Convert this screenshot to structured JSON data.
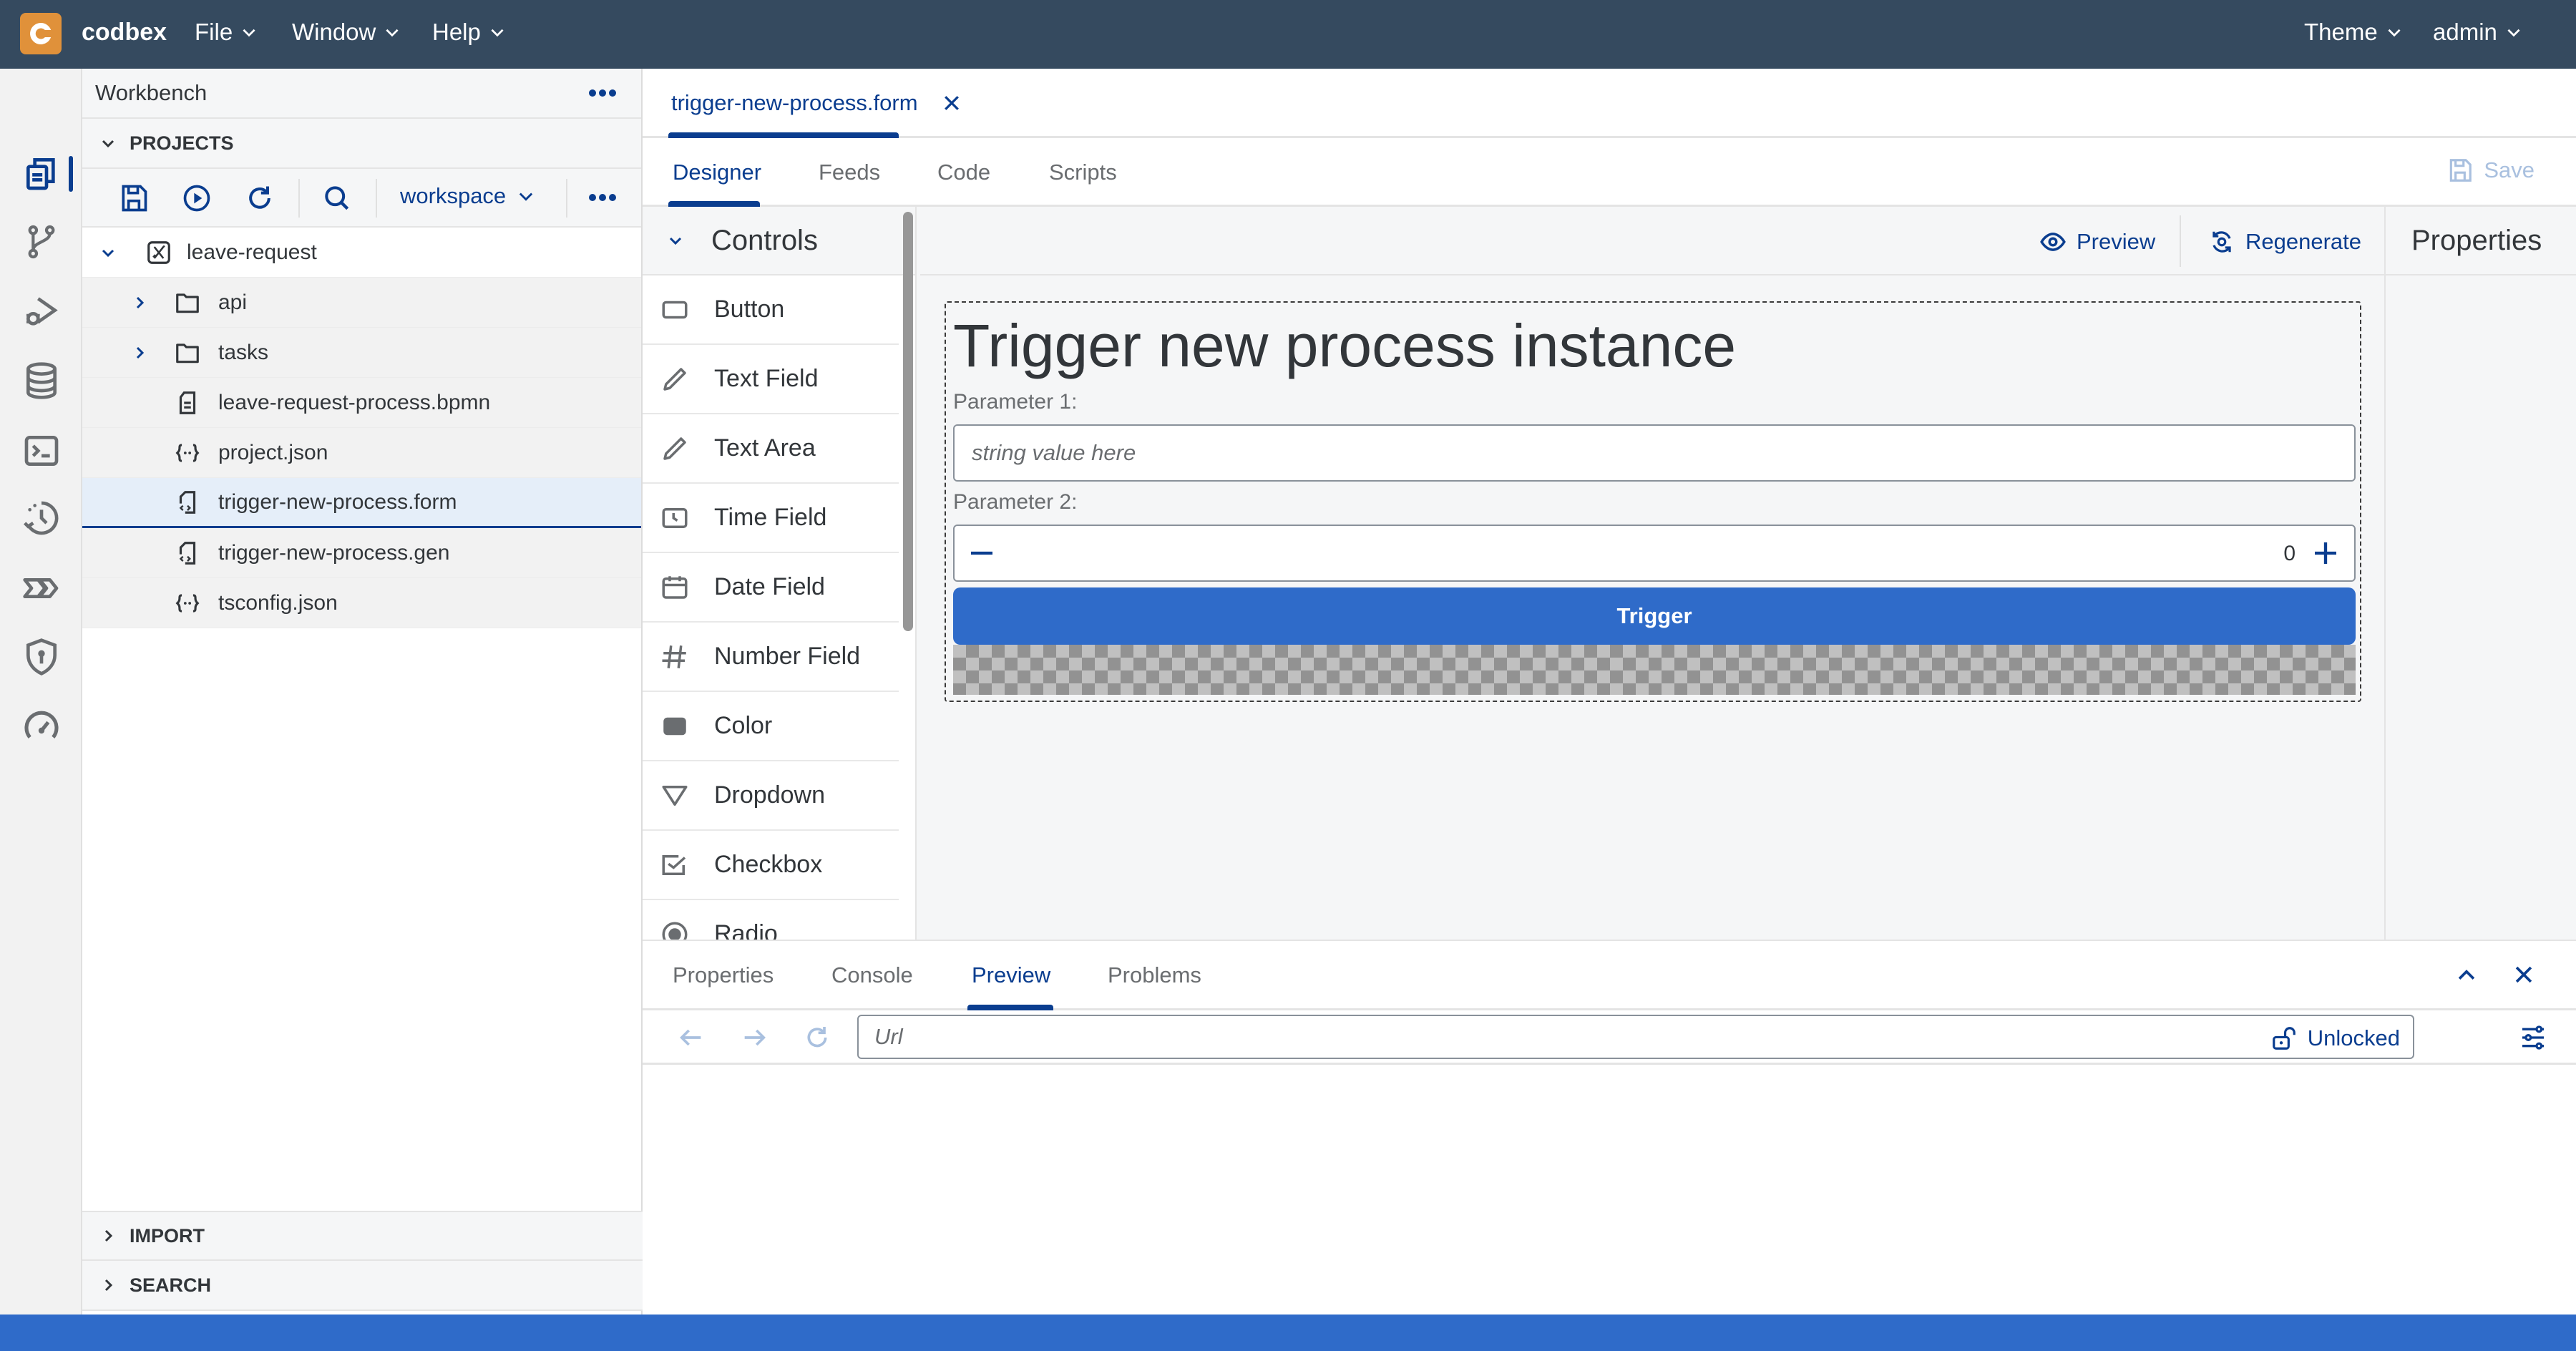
{
  "topbar": {
    "brand": "codbex",
    "menus": [
      "File",
      "Window",
      "Help"
    ],
    "right_menus": [
      "Theme",
      "admin"
    ]
  },
  "activity_bar": {
    "icons": [
      "workbench-icon",
      "git-icon",
      "debug-icon",
      "database-icon",
      "terminal-icon",
      "history-icon",
      "processes-icon",
      "security-icon",
      "dashboard-icon"
    ],
    "active": "workbench-icon"
  },
  "sidebar": {
    "title": "Workbench",
    "projects_section": "PROJECTS",
    "workspace": "workspace",
    "tree": [
      {
        "label": "leave-request",
        "type": "project",
        "expanded": true,
        "level": 0
      },
      {
        "label": "api",
        "type": "folder",
        "expanded": false,
        "level": 1
      },
      {
        "label": "tasks",
        "type": "folder",
        "expanded": false,
        "level": 1
      },
      {
        "label": "leave-request-process.bpmn",
        "type": "bpmn",
        "level": 1
      },
      {
        "label": "project.json",
        "type": "json",
        "level": 1
      },
      {
        "label": "trigger-new-process.form",
        "type": "form",
        "level": 1,
        "selected": true
      },
      {
        "label": "trigger-new-process.gen",
        "type": "form",
        "level": 1
      },
      {
        "label": "tsconfig.json",
        "type": "json",
        "level": 1
      }
    ],
    "import_section": "IMPORT",
    "search_section": "SEARCH"
  },
  "editor": {
    "open_tab": "trigger-new-process.form",
    "designer_tabs": [
      "Designer",
      "Feeds",
      "Code",
      "Scripts"
    ],
    "active_designer_tab": "Designer",
    "save_label": "Save"
  },
  "controls": {
    "title": "Controls",
    "items": [
      {
        "label": "Button",
        "icon": "button-icon"
      },
      {
        "label": "Text Field",
        "icon": "pencil-icon"
      },
      {
        "label": "Text Area",
        "icon": "pencil-icon"
      },
      {
        "label": "Time Field",
        "icon": "clock-icon"
      },
      {
        "label": "Date Field",
        "icon": "calendar-icon"
      },
      {
        "label": "Number Field",
        "icon": "hash-icon"
      },
      {
        "label": "Color",
        "icon": "color-swatch-icon"
      },
      {
        "label": "Dropdown",
        "icon": "dropdown-triangle-icon"
      },
      {
        "label": "Checkbox",
        "icon": "checkbox-icon"
      },
      {
        "label": "Radio",
        "icon": "radio-icon"
      }
    ]
  },
  "canvas": {
    "preview_label": "Preview",
    "regenerate_label": "Regenerate",
    "properties_title": "Properties",
    "form": {
      "title": "Trigger new process instance",
      "param1_label": "Parameter 1:",
      "param1_placeholder": "string value here",
      "param1_value": "",
      "param2_label": "Parameter 2:",
      "param2_value": "0",
      "button_label": "Trigger"
    }
  },
  "bottom_panel": {
    "tabs": [
      "Properties",
      "Console",
      "Preview",
      "Problems"
    ],
    "active_tab": "Preview",
    "url_placeholder": "Url",
    "lock_label": "Unlocked"
  },
  "colors": {
    "topbar": "#354a5f",
    "accent": "#0a3d8f",
    "primary_button": "#2f6bc9",
    "logo": "#e0913a",
    "statusbar": "#2f6bc9"
  }
}
